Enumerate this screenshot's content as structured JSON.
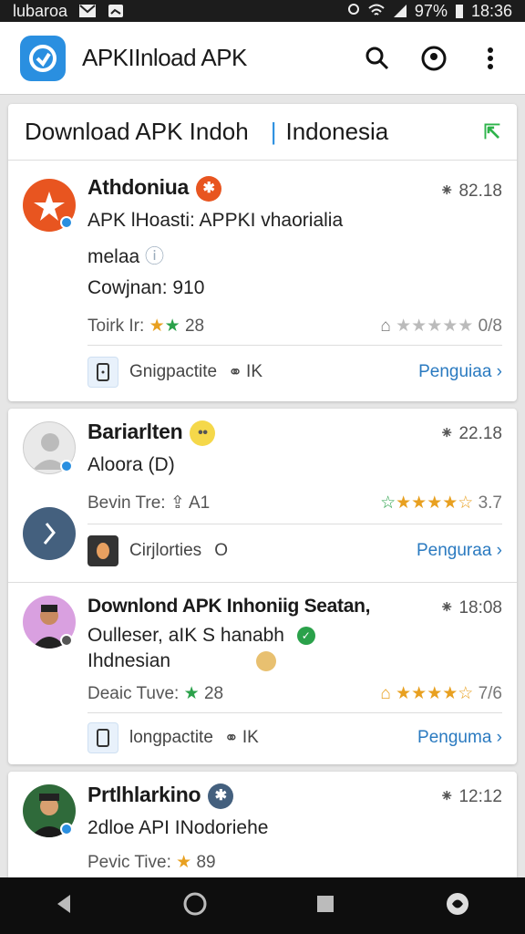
{
  "status": {
    "carrier": "lubaroa",
    "battery": "97%",
    "time": "18:36"
  },
  "appbar": {
    "title": "APKIInload APK"
  },
  "banner": {
    "left": "Download APK Indoh",
    "right": "Indonesia"
  },
  "apps": [
    {
      "name": "Athdoniua",
      "version": "⁕ 82.18",
      "desc1": "APK lHoasti: APPKI vhaorialia",
      "desc2": "melaa",
      "desc3": "Cowjnan: 910",
      "meta": "Toirk Ir:",
      "meta_num": "28",
      "rating": "0/8",
      "foot_label": "Gnigpactite",
      "foot_extra": "IK",
      "link": "Penguiaa"
    },
    {
      "name": "Bariarlten",
      "version": "⁕ 22.18",
      "desc1": "Aloora (D)",
      "meta": "Bevin Tre:",
      "meta_num": "A1",
      "rating": "3.7",
      "foot_label": "Cirjlorties",
      "foot_extra": "O",
      "link": "Penguraa"
    },
    {
      "name": "Downlond APK Inhoniig Seatan,",
      "version": "⁕ 18:08",
      "desc1": "Oulleser, aIK S hanabh",
      "desc2": "Ihdnesian",
      "meta": "Deaic Tuve:",
      "meta_num": "28",
      "rating": "7/6",
      "foot_label": "longpactite",
      "foot_extra": "IK",
      "link": "Penguma"
    },
    {
      "name": "Prtlhlarkino",
      "version": "⁕ 12:12",
      "desc1": "2dloe API INodoriehe",
      "meta": "Pevic Tive:",
      "meta_num": "89"
    }
  ],
  "colors": {
    "accent": "#2a8fe0",
    "link": "#2a7ac0",
    "star": "#e8a020",
    "green": "#2aa14a"
  }
}
